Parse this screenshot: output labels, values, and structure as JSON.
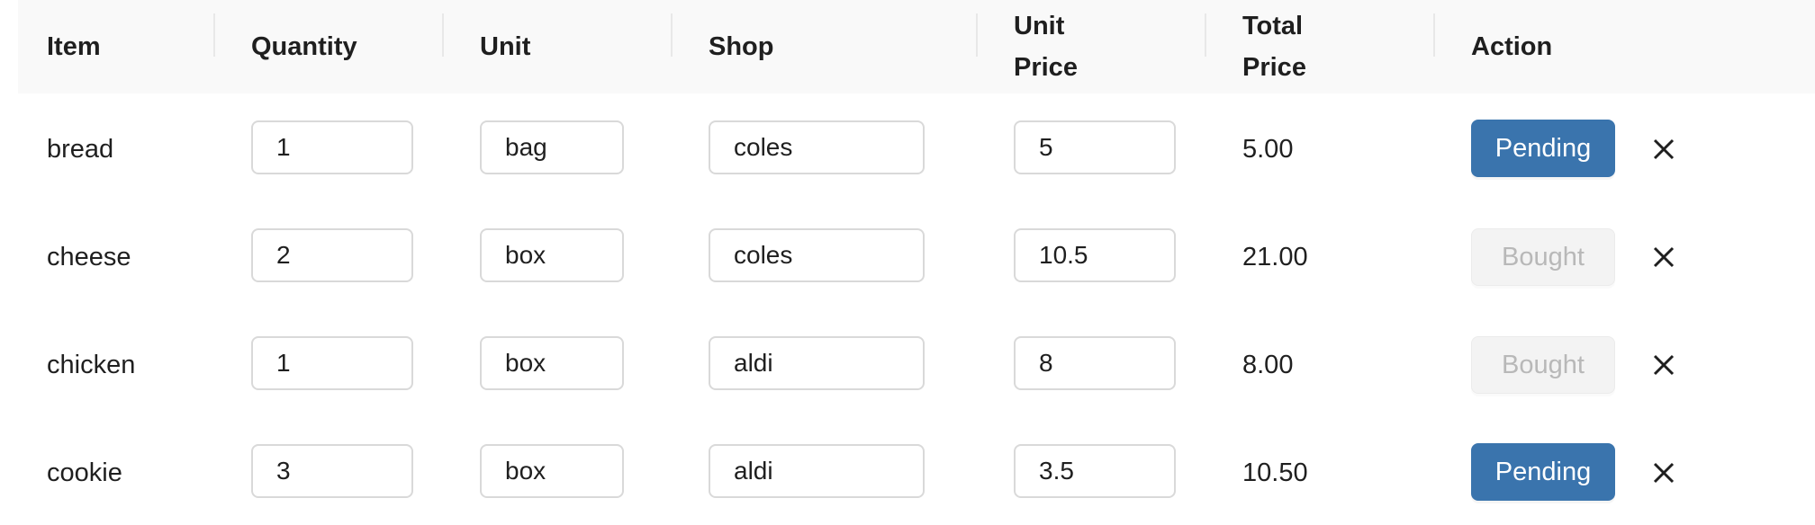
{
  "header": {
    "item": "Item",
    "quantity": "Quantity",
    "unit": "Unit",
    "shop": "Shop",
    "unit_price": "Unit Price",
    "total_price": "Total Price",
    "action": "Action"
  },
  "rows": [
    {
      "item": "bread",
      "quantity": "1",
      "unit": "bag",
      "shop": "coles",
      "unit_price": "5",
      "total_price": "5.00",
      "action": "Pending"
    },
    {
      "item": "cheese",
      "quantity": "2",
      "unit": "box",
      "shop": "coles",
      "unit_price": "10.5",
      "total_price": "21.00",
      "action": "Bought"
    },
    {
      "item": "chicken",
      "quantity": "1",
      "unit": "box",
      "shop": "aldi",
      "unit_price": "8",
      "total_price": "8.00",
      "action": "Bought"
    },
    {
      "item": "cookie",
      "quantity": "3",
      "unit": "box",
      "shop": "aldi",
      "unit_price": "3.5",
      "total_price": "10.50",
      "action": "Pending"
    }
  ],
  "icons": {
    "delete": "close-icon"
  },
  "colors": {
    "header_bg": "#f9f9f9",
    "pending_bg": "#3a74ad",
    "bought_bg": "#f3f3f3",
    "bought_text": "#b8b8b8"
  }
}
